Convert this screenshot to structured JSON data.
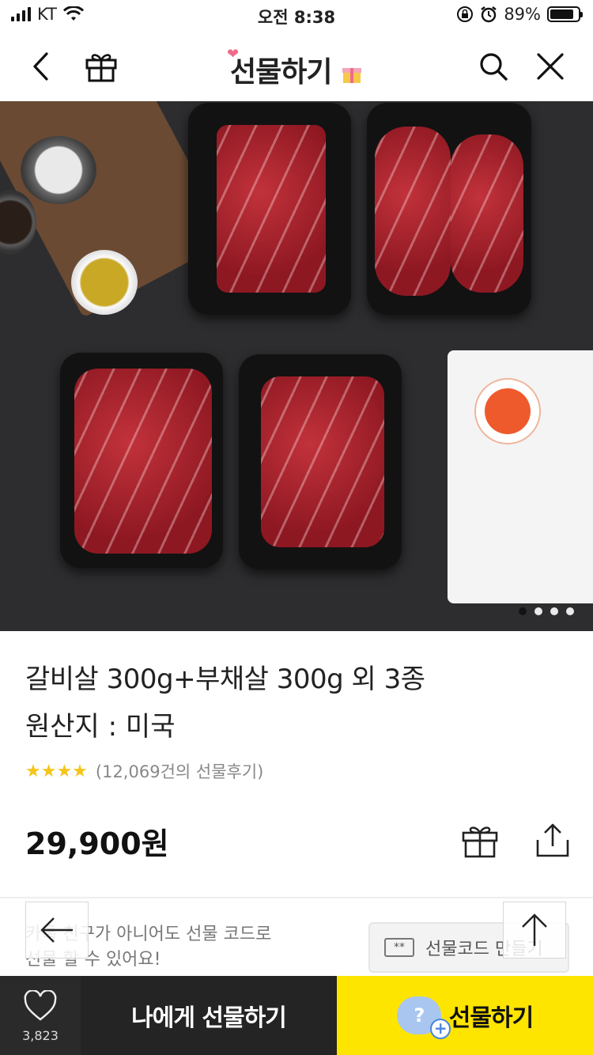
{
  "status_bar": {
    "carrier": "KT",
    "time": "오전 8:38",
    "battery": "89%"
  },
  "header": {
    "title": "선물하기",
    "back_icon": "chevron-left-icon",
    "gift_icon": "gift-icon",
    "search_icon": "search-icon",
    "close_icon": "close-icon"
  },
  "carousel": {
    "total": 4,
    "active": 1
  },
  "product": {
    "title": "갈비살 300g+부채살 300g 외 3종",
    "origin": "원산지 : 미국",
    "stars": "★★★★",
    "review_text": "(12,069건의 선물후기)",
    "price": "29,900원"
  },
  "promo": {
    "line1": "카톡 친구가 아니어도 선물 코드로",
    "line2": "선물 할 수 있어요!",
    "code_button_label": "선물코드 만들기",
    "code_icon_text": "**"
  },
  "bottom_bar": {
    "like_count": "3,823",
    "self_gift_label": "나에게 선물하기",
    "gift_label": "선물하기"
  },
  "colors": {
    "accent_yellow": "#fee500",
    "dark_button": "#242424",
    "star": "#f5c518"
  }
}
